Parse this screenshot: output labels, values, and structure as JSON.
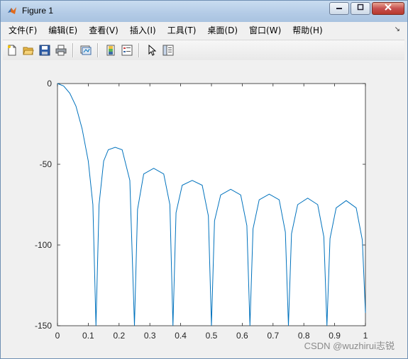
{
  "window": {
    "title": "Figure 1",
    "buttons": [
      "minimize",
      "maximize",
      "close"
    ]
  },
  "menu": {
    "items": [
      "文件(F)",
      "编辑(E)",
      "查看(V)",
      "插入(I)",
      "工具(T)",
      "桌面(D)",
      "窗口(W)",
      "帮助(H)"
    ]
  },
  "toolbar": {
    "icons": [
      "new-figure-icon",
      "open-file-icon",
      "save-icon",
      "print-icon",
      "link-plot-icon",
      "colorbar-icon",
      "legend-icon",
      "pointer-icon",
      "property-inspector-icon"
    ]
  },
  "watermark": "CSDN @wuzhirui志锐",
  "colors": {
    "line": "#0072bd",
    "axes_bg": "#ffffff",
    "window_bg": "#f0f0f0"
  },
  "chart_data": {
    "type": "line",
    "title": "",
    "xlabel": "",
    "ylabel": "",
    "xlim": [
      0,
      1
    ],
    "ylim": [
      -150,
      0
    ],
    "xticks": [
      "0",
      "0.1",
      "0.2",
      "0.3",
      "0.4",
      "0.5",
      "0.6",
      "0.7",
      "0.8",
      "0.9",
      "1"
    ],
    "yticks": [
      "0",
      "-50",
      "-100",
      "-150"
    ],
    "grid": false,
    "series": [
      {
        "name": "",
        "x": [
          0,
          0.02,
          0.04,
          0.06,
          0.08,
          0.1,
          0.115,
          0.125,
          0.135,
          0.15,
          0.165,
          0.1875,
          0.21,
          0.235,
          0.25,
          0.26,
          0.28,
          0.3125,
          0.345,
          0.365,
          0.375,
          0.385,
          0.405,
          0.4375,
          0.47,
          0.49,
          0.5,
          0.51,
          0.53,
          0.5625,
          0.595,
          0.615,
          0.625,
          0.635,
          0.655,
          0.6875,
          0.72,
          0.74,
          0.75,
          0.76,
          0.78,
          0.8125,
          0.845,
          0.865,
          0.875,
          0.885,
          0.905,
          0.9375,
          0.97,
          0.99,
          1.0
        ],
        "y": [
          0,
          -1.5,
          -6,
          -14,
          -28,
          -48,
          -75,
          -150,
          -75,
          -48,
          -41,
          -39.5,
          -41,
          -60,
          -150,
          -78,
          -56,
          -52.5,
          -56,
          -75,
          -150,
          -80,
          -63,
          -60,
          -63,
          -82,
          -150,
          -85,
          -69,
          -65.5,
          -69,
          -88,
          -150,
          -90,
          -72,
          -68.5,
          -72,
          -92,
          -150,
          -93,
          -75,
          -71,
          -75,
          -95,
          -150,
          -96,
          -77,
          -72.5,
          -77,
          -97,
          -142
        ]
      }
    ]
  }
}
